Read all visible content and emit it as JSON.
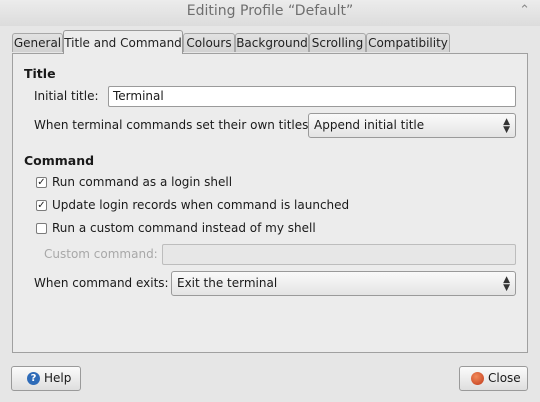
{
  "window": {
    "title": "Editing Profile “Default”",
    "close_glyph": "⌃"
  },
  "tabs": [
    {
      "label": "General"
    },
    {
      "label": "Title and Command"
    },
    {
      "label": "Colours"
    },
    {
      "label": "Background"
    },
    {
      "label": "Scrolling"
    },
    {
      "label": "Compatibility"
    }
  ],
  "active_tab": "Title and Command",
  "title_section": {
    "heading": "Title",
    "initial_title_label": "Initial title:",
    "initial_title_value": "Terminal",
    "dynamic_label": "When terminal commands set their own titles:",
    "dynamic_value": "Append initial title"
  },
  "command_section": {
    "heading": "Command",
    "login_shell_label": "Run command as a login shell",
    "login_shell_checked": true,
    "update_records_label": "Update login records when command is launched",
    "update_records_checked": true,
    "custom_command_label": "Run a custom command instead of my shell",
    "custom_command_checked": false,
    "custom_command_field_label": "Custom command:",
    "custom_command_value": "",
    "exit_label": "When command exits:",
    "exit_value": "Exit the terminal"
  },
  "buttons": {
    "help": "Help",
    "close": "Close"
  },
  "icons": {
    "help": "help-icon",
    "close": "close-icon",
    "checkmark": "✓",
    "combo_arrows": "⌃⌄"
  }
}
